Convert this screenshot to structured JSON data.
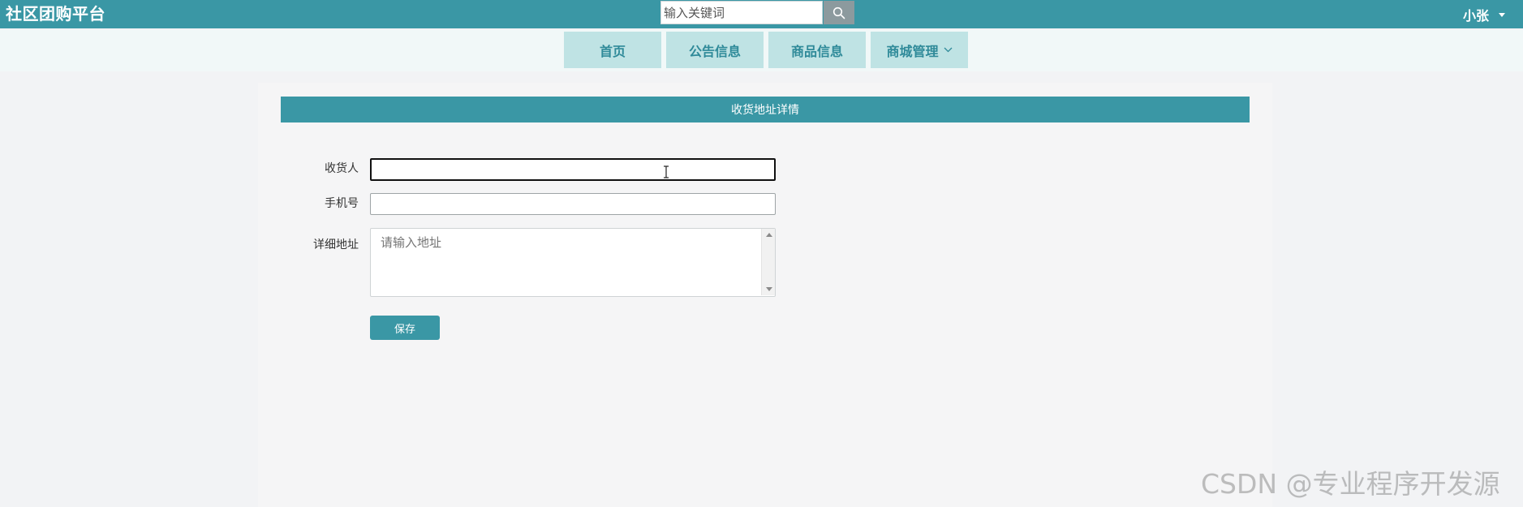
{
  "header": {
    "brand": "社区团购平台",
    "search_placeholder": "输入关键词",
    "user_name": "小张"
  },
  "nav": {
    "items": [
      {
        "label": "首页"
      },
      {
        "label": "公告信息"
      },
      {
        "label": "商品信息"
      },
      {
        "label": "商城管理",
        "has_dropdown": true
      }
    ]
  },
  "panel": {
    "title": "收货地址详情"
  },
  "form": {
    "receiver_label": "收货人",
    "receiver_value": "",
    "phone_label": "手机号",
    "phone_value": "",
    "address_label": "详细地址",
    "address_placeholder": "请输入地址",
    "address_value": "",
    "save_label": "保存"
  },
  "watermark": "CSDN @专业程序开发源",
  "colors": {
    "primary": "#3a97a5",
    "nav_item_bg": "#bfe3e4",
    "nav_text": "#2f8a99",
    "page_bg": "#f2f3f5"
  }
}
